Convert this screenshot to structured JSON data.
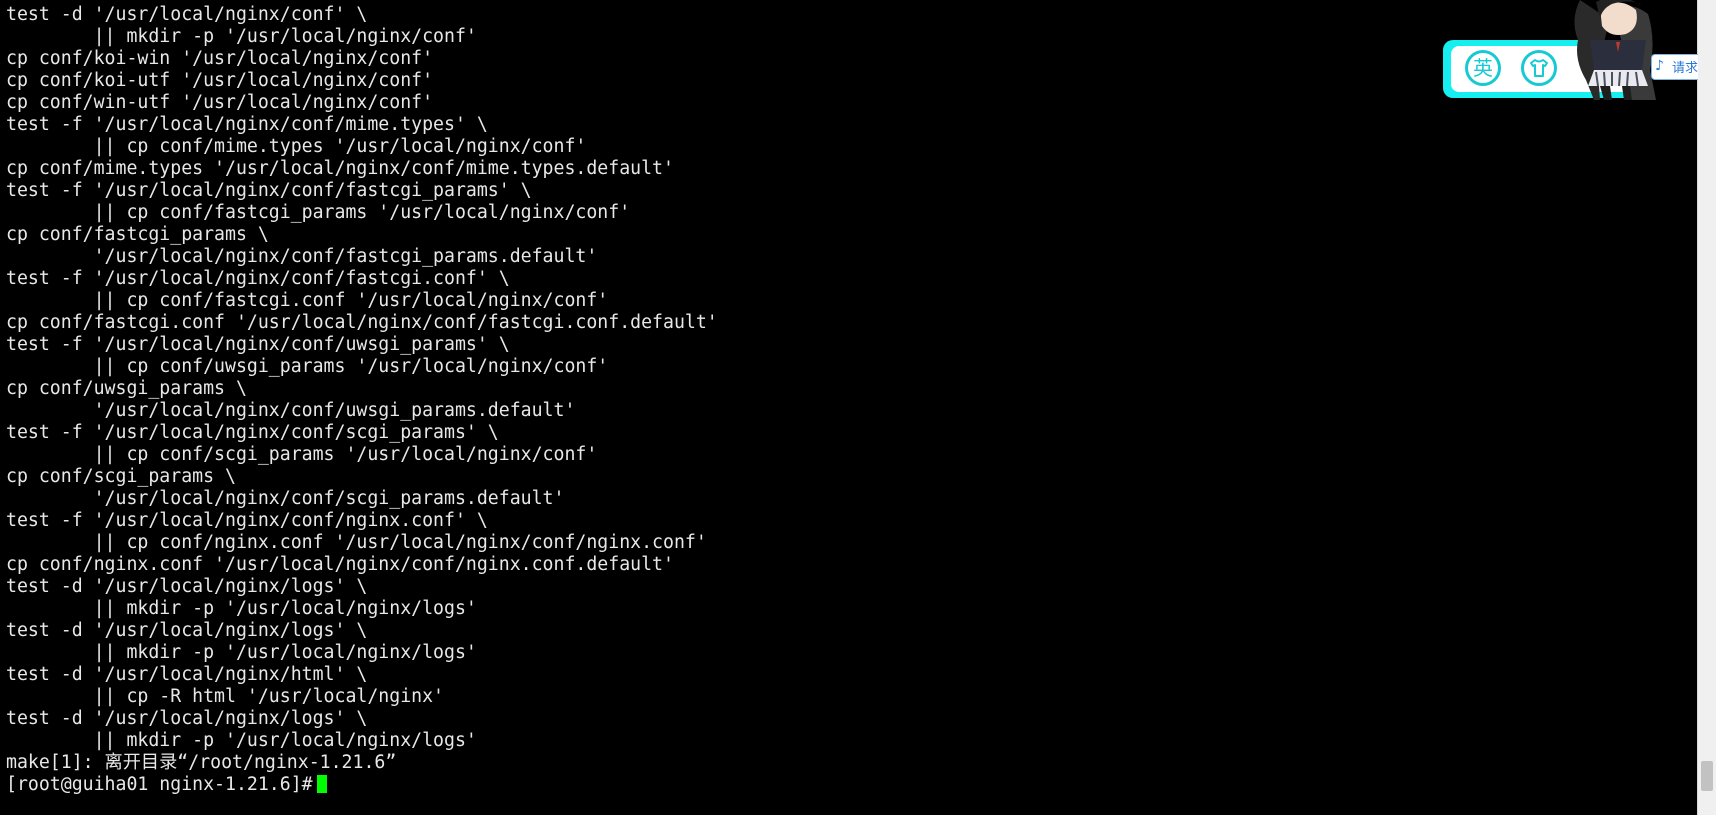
{
  "terminal": {
    "lines": [
      "test -d '/usr/local/nginx/conf' \\",
      "        || mkdir -p '/usr/local/nginx/conf'",
      "cp conf/koi-win '/usr/local/nginx/conf'",
      "cp conf/koi-utf '/usr/local/nginx/conf'",
      "cp conf/win-utf '/usr/local/nginx/conf'",
      "test -f '/usr/local/nginx/conf/mime.types' \\",
      "        || cp conf/mime.types '/usr/local/nginx/conf'",
      "cp conf/mime.types '/usr/local/nginx/conf/mime.types.default'",
      "test -f '/usr/local/nginx/conf/fastcgi_params' \\",
      "        || cp conf/fastcgi_params '/usr/local/nginx/conf'",
      "cp conf/fastcgi_params \\",
      "        '/usr/local/nginx/conf/fastcgi_params.default'",
      "test -f '/usr/local/nginx/conf/fastcgi.conf' \\",
      "        || cp conf/fastcgi.conf '/usr/local/nginx/conf'",
      "cp conf/fastcgi.conf '/usr/local/nginx/conf/fastcgi.conf.default'",
      "test -f '/usr/local/nginx/conf/uwsgi_params' \\",
      "        || cp conf/uwsgi_params '/usr/local/nginx/conf'",
      "cp conf/uwsgi_params \\",
      "        '/usr/local/nginx/conf/uwsgi_params.default'",
      "test -f '/usr/local/nginx/conf/scgi_params' \\",
      "        || cp conf/scgi_params '/usr/local/nginx/conf'",
      "cp conf/scgi_params \\",
      "        '/usr/local/nginx/conf/scgi_params.default'",
      "test -f '/usr/local/nginx/conf/nginx.conf' \\",
      "        || cp conf/nginx.conf '/usr/local/nginx/conf/nginx.conf'",
      "cp conf/nginx.conf '/usr/local/nginx/conf/nginx.conf.default'",
      "test -d '/usr/local/nginx/logs' \\",
      "        || mkdir -p '/usr/local/nginx/logs'",
      "test -d '/usr/local/nginx/logs' \\",
      "        || mkdir -p '/usr/local/nginx/logs'",
      "test -d '/usr/local/nginx/html' \\",
      "        || cp -R html '/usr/local/nginx'",
      "test -d '/usr/local/nginx/logs' \\",
      "        || mkdir -p '/usr/local/nginx/logs'",
      "make[1]: 离开目录“/root/nginx-1.21.6”"
    ],
    "prompt": "[root@guiha01 nginx-1.21.6]#",
    "cursor_color": "#00ff00",
    "background_color": "#000000",
    "text_color": "#e8e8e8"
  },
  "ime_toolbar": {
    "lang_label": "英",
    "skin_icon": "tshirt-icon",
    "tab_label": "请求",
    "tab_icon": "music-note-icon",
    "accent_color": "#17eef0"
  },
  "scrollbar": {
    "position_fraction": 0.97
  }
}
